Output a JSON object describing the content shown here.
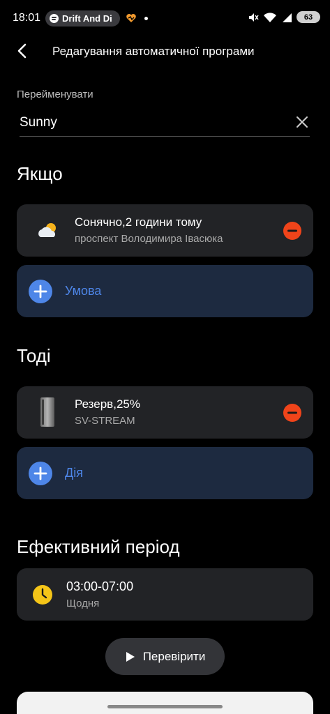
{
  "status_bar": {
    "time": "18:01",
    "media_pill_text": "Drift And Di",
    "battery": "63"
  },
  "header": {
    "title": "Редагування автоматичної програми"
  },
  "rename": {
    "label": "Перейменувати",
    "value": "Sunny"
  },
  "if_section": {
    "title": "Якщо",
    "condition": {
      "title": "Сонячно,2 години тому",
      "subtitle": "проспект Володимира Івасюка",
      "icon": "weather-sun-cloud-icon"
    },
    "add_label": "Умова"
  },
  "then_section": {
    "title": "Тоді",
    "action": {
      "title": "Резерв,25%",
      "subtitle": "SV-STREAM",
      "icon": "battery-device-icon"
    },
    "add_label": "Дія"
  },
  "period_section": {
    "title": "Ефективний період",
    "time_range": "03:00-07:00",
    "repeat": "Щодня"
  },
  "check_button": {
    "label": "Перевірити"
  },
  "colors": {
    "accent_blue": "#4e86e8",
    "remove_red": "#f0441a",
    "clock_yellow": "#f5c518",
    "card_bg": "#222326",
    "add_card_bg": "#1d2a40"
  }
}
